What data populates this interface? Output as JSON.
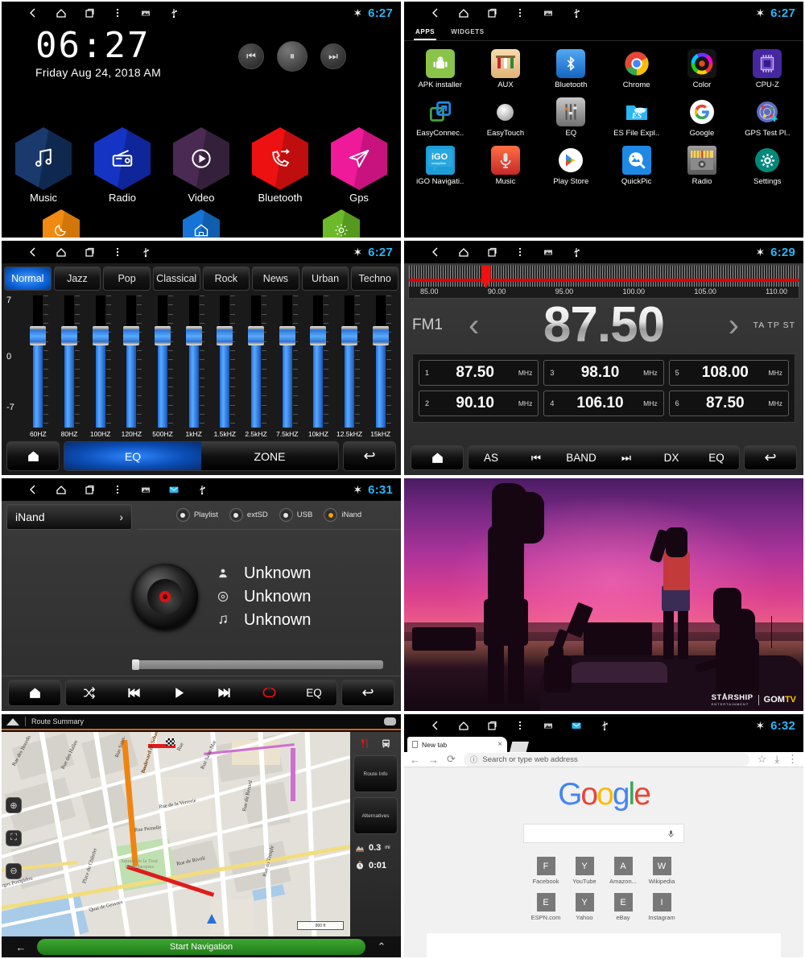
{
  "statusbar": {
    "icons": [
      "back-icon",
      "home-icon",
      "recents-icon",
      "overflow-icon",
      "screenshot-icon",
      "usb-icon"
    ],
    "bluetooth_glyph": "✶",
    "times": {
      "home": "6:27",
      "apps": "6:27",
      "eq": "6:27",
      "radio": "6:29",
      "music": "6:31",
      "chrome": "6:32"
    },
    "time_color": "#29b6f6"
  },
  "home": {
    "clock": "06:27",
    "date": "Friday Aug 24, 2018 AM",
    "media_buttons": [
      {
        "name": "previous-track-button",
        "glyph": "⏮"
      },
      {
        "name": "play-pause-button",
        "glyph": "⏸"
      },
      {
        "name": "next-track-button",
        "glyph": "⏭"
      }
    ],
    "tiles": [
      {
        "label": "Music",
        "icon": "music-note-icon",
        "color": "#1a3a6e",
        "color2": "#0f2850"
      },
      {
        "label": "Radio",
        "icon": "radio-icon",
        "color": "#1534c4",
        "color2": "#0f259a"
      },
      {
        "label": "Video",
        "icon": "play-circle-icon",
        "color": "#4a2a52",
        "color2": "#35203c"
      },
      {
        "label": "Bluetooth",
        "icon": "phone-call-icon",
        "color": "#ee1111",
        "color2": "#c00d0d"
      },
      {
        "label": "Gps",
        "icon": "paper-plane-icon",
        "color": "#ee1a9a",
        "color2": "#c8137f"
      }
    ],
    "sub_tiles": [
      {
        "label": "",
        "icon": "moon-icon",
        "color": "#f08a12",
        "color2": "#d3760a"
      },
      {
        "label": "",
        "icon": "home-tile-icon",
        "color": "#1674d6",
        "color2": "#105ead"
      },
      {
        "label": "",
        "icon": "settings-gear-icon",
        "color": "#6cba2b",
        "color2": "#559a1e"
      }
    ]
  },
  "apps": {
    "tabs": [
      {
        "label": "APPS",
        "active": true
      },
      {
        "label": "WIDGETS",
        "active": false
      }
    ],
    "items": [
      {
        "label": "APK installer",
        "icon": "android-robot-icon",
        "bg": "#8bc34a",
        "glyph": "🤖",
        "fg": "#ffffff"
      },
      {
        "label": "AUX",
        "icon": "aux-cable-icon",
        "bg": "#f5c77e",
        "glyph": "‖",
        "fg": "#6b4a22"
      },
      {
        "label": "Bluetooth",
        "icon": "bluetooth-icon",
        "bg": "#1e88e5",
        "glyph": "✶",
        "fg": "#ffffff"
      },
      {
        "label": "Chrome",
        "icon": "chrome-icon",
        "bg": "#000000",
        "glyph": "",
        "fg": "#ffffff"
      },
      {
        "label": "Color",
        "icon": "color-wheel-icon",
        "bg": "#111111",
        "glyph": "",
        "fg": "#ffffff"
      },
      {
        "label": "CPU-Z",
        "icon": "cpu-chip-icon",
        "bg": "#4527a0",
        "glyph": "▦",
        "fg": "#ffffff"
      },
      {
        "label": "EasyConnec..",
        "icon": "easyconnect-icon",
        "bg": "#000000",
        "glyph": "↗",
        "fg": "#4caf50"
      },
      {
        "label": "EasyTouch",
        "icon": "easytouch-icon",
        "bg": "#000000",
        "glyph": "●",
        "fg": "#e8e8e8"
      },
      {
        "label": "EQ",
        "icon": "equalizer-icon",
        "bg": "#9e9e9e",
        "glyph": "‖",
        "fg": "#ffffff"
      },
      {
        "label": "ES File Expl..",
        "icon": "es-file-explorer-icon",
        "bg": "#29b6f6",
        "glyph": "ES",
        "fg": "#ffffff"
      },
      {
        "label": "Google",
        "icon": "google-g-icon",
        "bg": "#ffffff",
        "glyph": "G",
        "fg": "#4285f4"
      },
      {
        "label": "GPS Test Pl..",
        "icon": "gps-test-icon",
        "bg": "#3f51b5",
        "glyph": "◌",
        "fg": "#ffffff"
      },
      {
        "label": "iGO Navigati..",
        "icon": "igo-navigation-icon",
        "bg": "#1e9cd7",
        "glyph": "iGO",
        "fg": "#ffffff"
      },
      {
        "label": "Music",
        "icon": "music-mic-icon",
        "bg": "#e53935",
        "glyph": "🎤",
        "fg": "#ffffff"
      },
      {
        "label": "Play Store",
        "icon": "play-store-icon",
        "bg": "#ffffff",
        "glyph": "▶",
        "fg": "#34a853"
      },
      {
        "label": "QuickPic",
        "icon": "quickpic-icon",
        "bg": "#1e88e5",
        "glyph": "🖼",
        "fg": "#ffffff"
      },
      {
        "label": "Radio",
        "icon": "radio-app-icon",
        "bg": "#7a7a7a",
        "glyph": "▤",
        "fg": "#ffffff"
      },
      {
        "label": "Settings",
        "icon": "settings-gear-icon",
        "bg": "#00897b",
        "glyph": "⚙",
        "fg": "#ffffff"
      }
    ]
  },
  "eq": {
    "presets": [
      "Normal",
      "Jazz",
      "Pop",
      "Classical",
      "Rock",
      "News",
      "Urban",
      "Techno"
    ],
    "active_preset": "Normal",
    "scale": {
      "max": "7",
      "mid": "0",
      "min": "-7"
    },
    "bands": [
      {
        "label": "60HZ",
        "value": 0
      },
      {
        "label": "80HZ",
        "value": 0
      },
      {
        "label": "100HZ",
        "value": 0
      },
      {
        "label": "120HZ",
        "value": 0
      },
      {
        "label": "500HZ",
        "value": 0
      },
      {
        "label": "1kHZ",
        "value": 0
      },
      {
        "label": "1.5kHZ",
        "value": 0
      },
      {
        "label": "2.5kHZ",
        "value": 0
      },
      {
        "label": "7.5kHZ",
        "value": 0
      },
      {
        "label": "10kHZ",
        "value": 0
      },
      {
        "label": "12.5kHZ",
        "value": 0
      },
      {
        "label": "15kHZ",
        "value": 0
      }
    ],
    "bottom": {
      "home_glyph": "⌂",
      "eq_label": "EQ",
      "zone_label": "ZONE",
      "back_glyph": "↩"
    }
  },
  "radio": {
    "band": "FM1",
    "frequency": "87.50",
    "dial_ticks": [
      "85.00",
      "90.00",
      "95.00",
      "100.00",
      "105.00",
      "110.00"
    ],
    "indicators": "TA TP ST",
    "prev_glyph": "‹",
    "next_glyph": "›",
    "presets": [
      {
        "num": "1",
        "value": "87.50",
        "unit": "MHz"
      },
      {
        "num": "3",
        "value": "98.10",
        "unit": "MHz"
      },
      {
        "num": "5",
        "value": "108.00",
        "unit": "MHz"
      },
      {
        "num": "2",
        "value": "90.10",
        "unit": "MHz"
      },
      {
        "num": "4",
        "value": "106.10",
        "unit": "MHz"
      },
      {
        "num": "6",
        "value": "87.50",
        "unit": "MHz"
      }
    ],
    "bottom": {
      "home_glyph": "⌂",
      "items": [
        "AS",
        "⏮",
        "BAND",
        "⏭",
        "DX",
        "EQ"
      ],
      "back_glyph": "↩"
    }
  },
  "music": {
    "source_label": "iNand",
    "source_chevron": "›",
    "sources": [
      {
        "label": "Playlist",
        "selected": false
      },
      {
        "label": "extSD",
        "selected": false
      },
      {
        "label": "USB",
        "selected": false
      },
      {
        "label": "iNand",
        "selected": true
      }
    ],
    "meta": [
      {
        "icon": "artist-icon",
        "glyph": "👤",
        "value": "Unknown"
      },
      {
        "icon": "album-icon",
        "glyph": "◎",
        "value": "Unknown"
      },
      {
        "icon": "track-icon",
        "glyph": "♫",
        "value": "Unknown"
      }
    ],
    "progress_percent": 1,
    "bottom": {
      "home_glyph": "⌂",
      "items": [
        {
          "name": "shuffle-button",
          "glyph": "⤨",
          "color": "#ffffff"
        },
        {
          "name": "previous-button",
          "glyph": "⏮",
          "color": "#ffffff"
        },
        {
          "name": "play-button",
          "glyph": "▶",
          "color": "#ffffff"
        },
        {
          "name": "next-button",
          "glyph": "⏭",
          "color": "#ffffff"
        },
        {
          "name": "repeat-button",
          "glyph": "↻",
          "color": "#ee1111"
        },
        {
          "name": "eq-button",
          "glyph": "EQ",
          "color": "#ffffff"
        }
      ],
      "back_glyph": "↩"
    }
  },
  "video": {
    "watermark_primary": "STÅRSHIP",
    "watermark_primary_sub": "ENTERTAINMENT",
    "watermark_secondary": "GOM",
    "watermark_secondary_accent": "TV"
  },
  "navigation": {
    "title": "Route Summary",
    "zoom_in_glyph": "⊕",
    "recenter_glyph": "⛶",
    "zoom_out_glyph": "⊖",
    "side_icons": [
      {
        "name": "restaurant-poi-icon",
        "glyph": "🍴",
        "color": "#d01b1b"
      },
      {
        "name": "vehicle-icon",
        "glyph": "🚌",
        "color": "#e8e8e8"
      }
    ],
    "side_buttons": [
      "Route Info",
      "Alternatives"
    ],
    "stats": [
      {
        "icon": "distance-icon",
        "glyph": "⛰",
        "value": "0.3",
        "unit": "mi"
      },
      {
        "icon": "time-icon",
        "glyph": "⏱",
        "value": "0:01",
        "unit": ""
      }
    ],
    "back_glyph": "←",
    "start_label": "Start Navigation",
    "expand_glyph": "⌃",
    "scale_label": "800 ft",
    "street_labels": [
      "Rue des Bourdo",
      "Rue des Halles",
      "Rue Saint-",
      "Boulevard de Sébastopol",
      "Rue",
      "Rue Saint-Mar",
      "Rue de la Verrerie",
      "Rue Pernelle",
      "Rue du Renard",
      "Rue du Temple",
      "Rue de Rivoli",
      "Square de la Tour Saint-Jacques",
      "Place du Châtelet",
      "Quai de Gesvres",
      "rges Pompidou"
    ]
  },
  "chrome": {
    "tab_title": "New tab",
    "tab_close_glyph": "×",
    "toolbar": {
      "back_glyph": "←",
      "forward_glyph": "→",
      "reload_glyph": "⟳",
      "omnibox_info_glyph": "ⓘ",
      "omnibox_placeholder": "Search or type web address",
      "bookmark_glyph": "☆",
      "download_glyph": "⤓",
      "menu_glyph": "⋮"
    },
    "logo": "Google",
    "logo_colors": [
      "#4285F4",
      "#EA4335",
      "#FBBC05",
      "#4285F4",
      "#34A853",
      "#EA4335"
    ],
    "search_mic_glyph": "🎤",
    "shortcuts": [
      {
        "letter": "F",
        "label": "Facebook"
      },
      {
        "letter": "Y",
        "label": "YouTube"
      },
      {
        "letter": "A",
        "label": "Amazon..."
      },
      {
        "letter": "W",
        "label": "Wikipedia"
      },
      {
        "letter": "E",
        "label": "ESPN.com"
      },
      {
        "letter": "Y",
        "label": "Yahoo"
      },
      {
        "letter": "E",
        "label": "eBay"
      },
      {
        "letter": "I",
        "label": "Instagram"
      }
    ]
  }
}
